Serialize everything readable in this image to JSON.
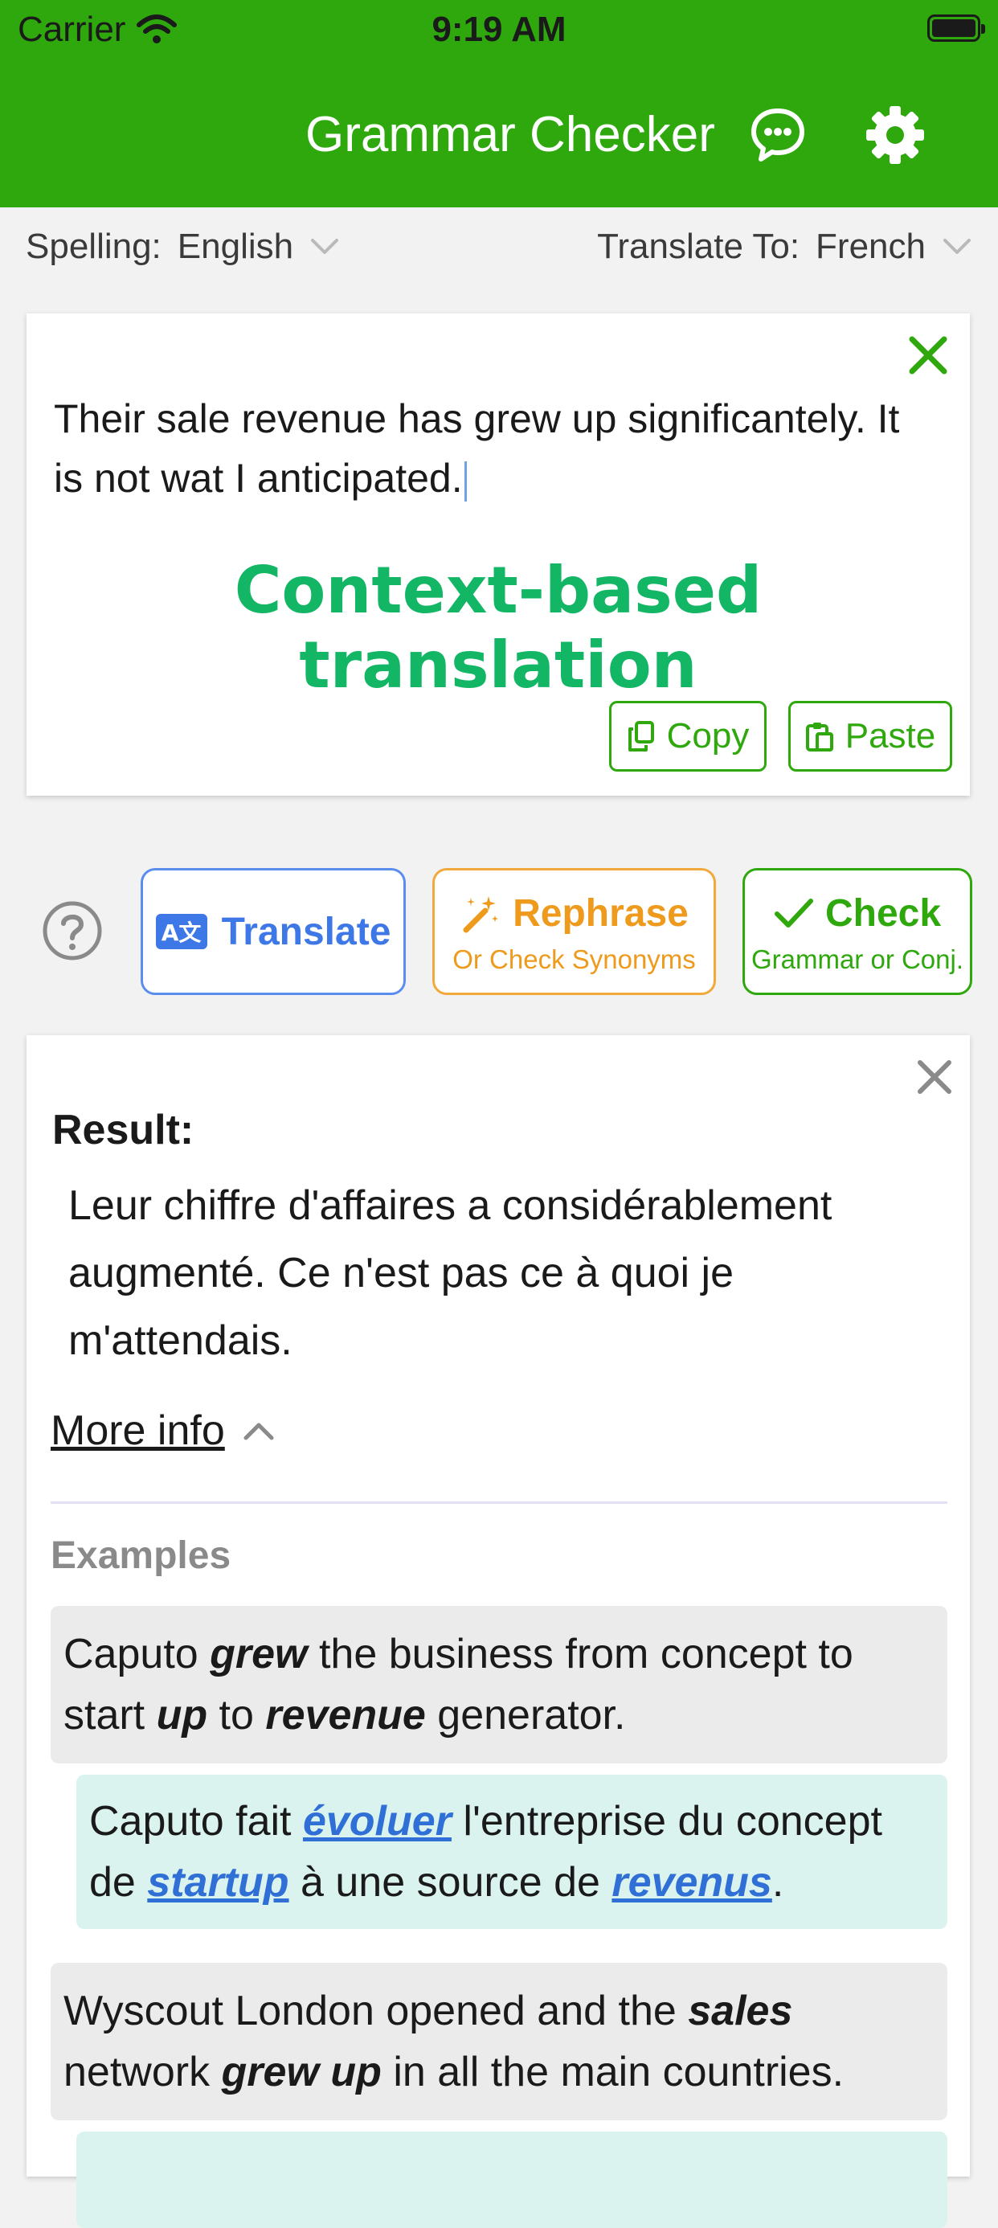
{
  "status_bar": {
    "carrier": "Carrier",
    "time": "9:19 AM",
    "icons": [
      "wifi-icon",
      "battery-icon"
    ]
  },
  "header": {
    "title": "Grammar Checker",
    "icons": [
      "chat-icon",
      "settings-icon"
    ],
    "background": "#2ea80d"
  },
  "lang_bar": {
    "spelling_label": "Spelling:",
    "spelling_value": "English",
    "translate_label": "Translate To:",
    "translate_value": "French"
  },
  "input": {
    "text": "Their sale revenue has grew up significantely. It is not wat I anticipated.",
    "caption": "Context-based translation",
    "copy_label": "Copy",
    "paste_label": "Paste"
  },
  "actions": {
    "translate_label": "Translate",
    "translate_icon_text": "A文",
    "rephrase_label": "Rephrase",
    "rephrase_sub": "Or Check Synonyms",
    "check_label": "Check",
    "check_sub": "Grammar or Conj."
  },
  "result": {
    "label": "Result:",
    "text": "Leur chiffre d'affaires a considérablement augmenté. Ce n'est pas ce à quoi je m'attendais.",
    "more_info": "More info",
    "examples_label": "Examples",
    "examples": [
      {
        "source": [
          {
            "t": "Caputo ",
            "b": false
          },
          {
            "t": "grew",
            "b": true
          },
          {
            "t": " the business from concept to start ",
            "b": false
          },
          {
            "t": "up",
            "b": true
          },
          {
            "t": " to ",
            "b": false
          },
          {
            "t": "revenue",
            "b": true
          },
          {
            "t": " generator.",
            "b": false
          }
        ],
        "translation": [
          {
            "t": "Caputo fait ",
            "b": false
          },
          {
            "t": "évoluer",
            "b": true
          },
          {
            "t": " l'entreprise du concept de ",
            "b": false
          },
          {
            "t": "startup",
            "b": true
          },
          {
            "t": " à une source de ",
            "b": false
          },
          {
            "t": "revenus",
            "b": true
          },
          {
            "t": ".",
            "b": false
          }
        ]
      },
      {
        "source": [
          {
            "t": "Wyscout London opened and the ",
            "b": false
          },
          {
            "t": "sales",
            "b": true
          },
          {
            "t": " network ",
            "b": false
          },
          {
            "t": "grew up",
            "b": true
          },
          {
            "t": " in all the main countries.",
            "b": false
          }
        ],
        "translation": []
      }
    ]
  },
  "colors": {
    "accent_green": "#2ea80d",
    "caption_green": "#12b665",
    "translate_blue": "#3d78e6",
    "rephrase_orange": "#ee9a1d",
    "link_blue": "#2f6fd6",
    "translation_bg": "#daf3ef"
  }
}
